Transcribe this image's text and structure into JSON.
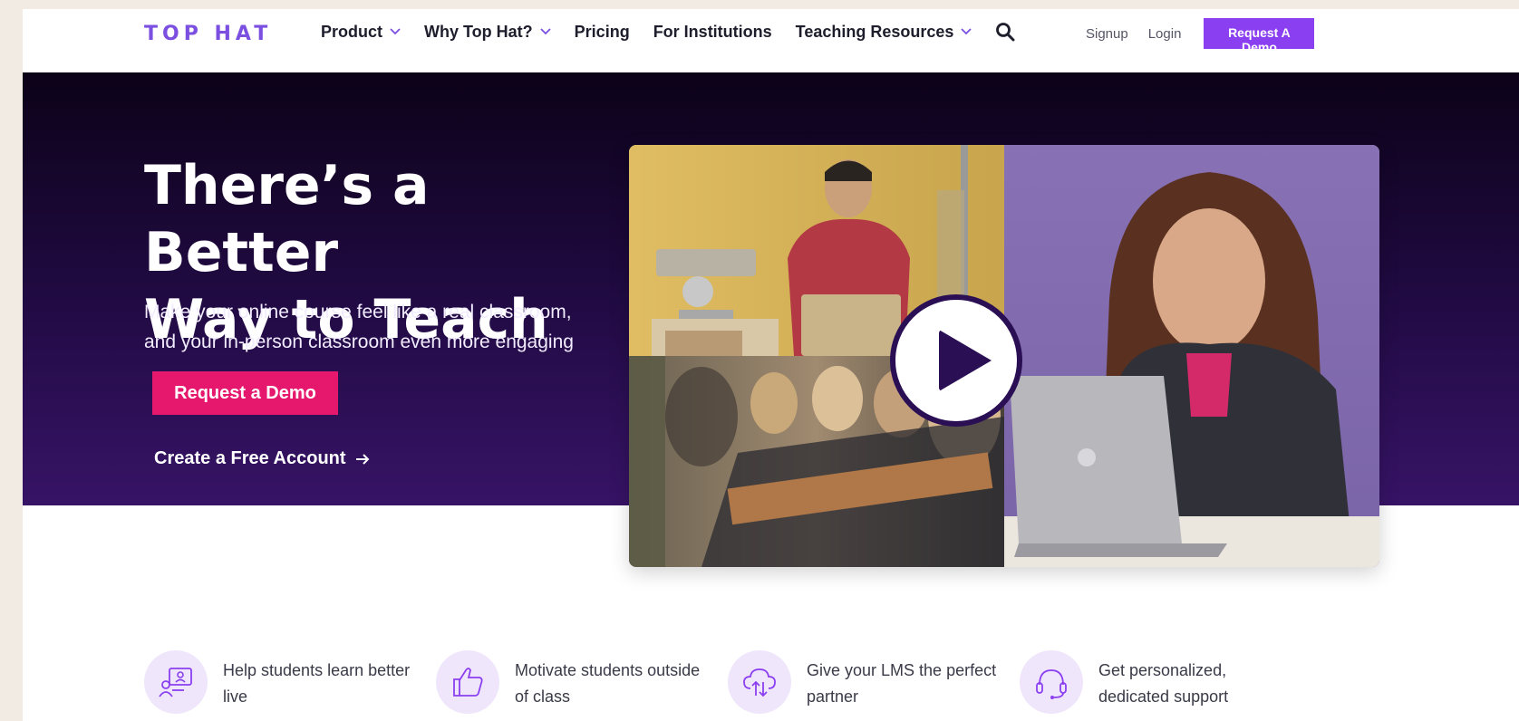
{
  "nav": {
    "logo": "TOP HAT",
    "items": [
      {
        "label": "Product",
        "has_dropdown": true
      },
      {
        "label": "Why Top Hat?",
        "has_dropdown": true
      },
      {
        "label": "Pricing",
        "has_dropdown": false
      },
      {
        "label": "For Institutions",
        "has_dropdown": false
      },
      {
        "label": "Teaching Resources",
        "has_dropdown": true
      }
    ],
    "search_icon": "search-icon",
    "signup": "Signup",
    "login": "Login",
    "request_demo": "Request A Demo"
  },
  "hero": {
    "title_line1": "There’s a Better",
    "title_line2": "Way to Teach",
    "subtitle_line1": "Make your online course feel like a real classroom,",
    "subtitle_line2": "and your in-person classroom even more engaging",
    "cta_primary": "Request a Demo",
    "cta_secondary": "Create a Free Account",
    "video_play_icon": "play-icon"
  },
  "features": [
    {
      "icon": "live-teaching-icon",
      "line1": "Help students learn better",
      "line2": "live"
    },
    {
      "icon": "thumbs-up-icon",
      "line1": "Motivate students outside",
      "line2": "of class"
    },
    {
      "icon": "cloud-sync-icon",
      "line1": "Give your LMS the perfect",
      "line2": "partner"
    },
    {
      "icon": "headset-icon",
      "line1": "Get personalized,",
      "line2": "dedicated support"
    }
  ],
  "colors": {
    "brand_purple": "#7b4fe0",
    "demo_button": "#8a3ff0",
    "hero_cta": "#e5186e",
    "hero_bg_dark": "#0c0218",
    "hero_bg_light": "#371366"
  }
}
